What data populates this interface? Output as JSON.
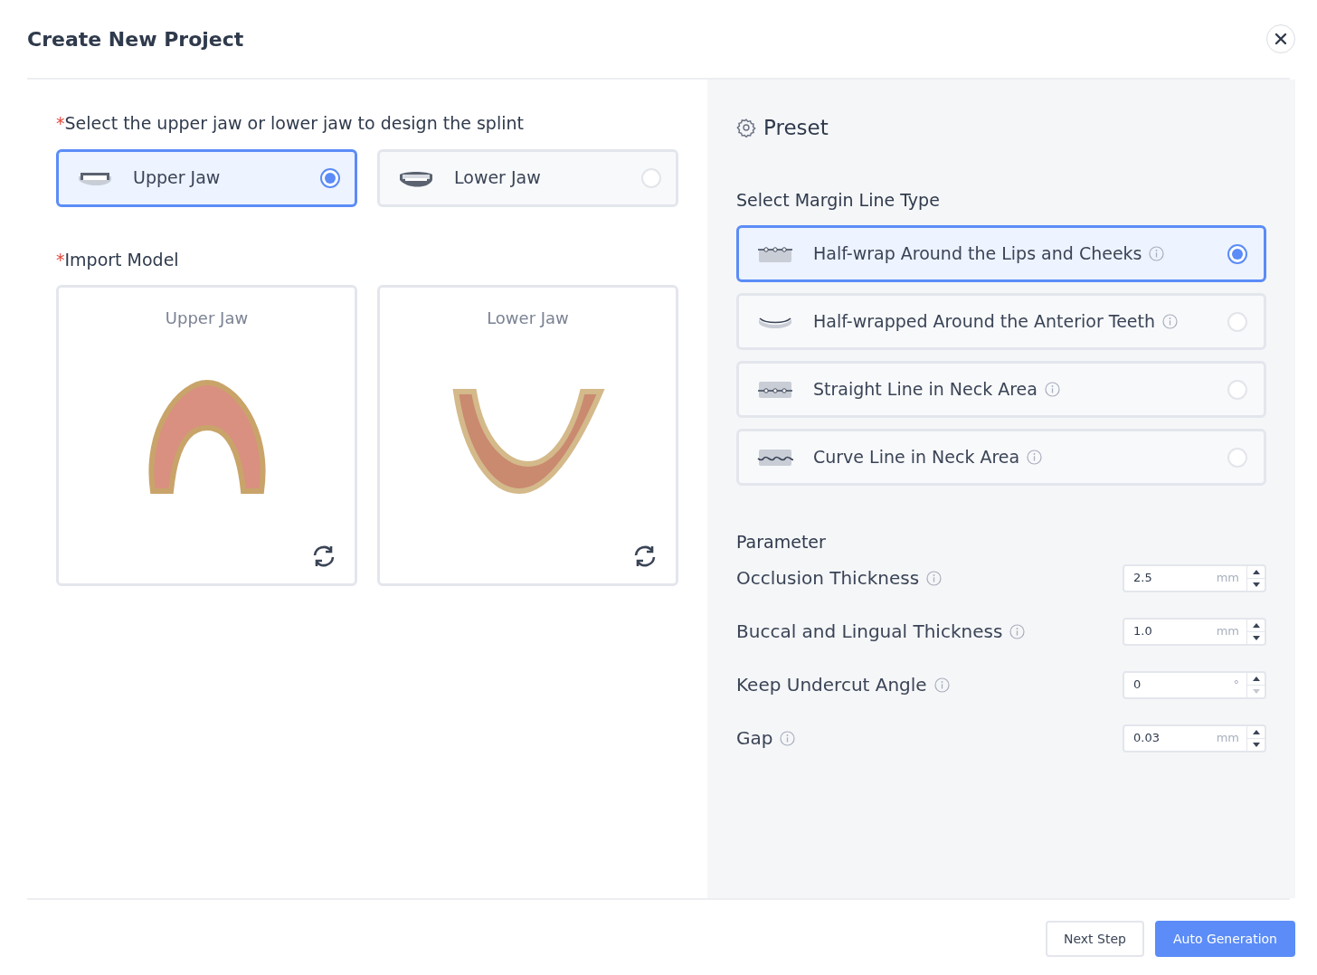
{
  "dialog": {
    "title": "Create New Project"
  },
  "jaw_section": {
    "required_mark": "*",
    "label": "Select the upper jaw or lower jaw to design the splint",
    "options": [
      {
        "label": "Upper Jaw",
        "selected": true,
        "kind": "upper"
      },
      {
        "label": "Lower Jaw",
        "selected": false,
        "kind": "lower"
      }
    ]
  },
  "import_section": {
    "required_mark": "*",
    "label": "Import Model",
    "models": [
      {
        "label": "Upper Jaw",
        "kind": "upper"
      },
      {
        "label": "Lower Jaw",
        "kind": "lower"
      }
    ]
  },
  "preset": {
    "title": "Preset",
    "margin_label": "Select Margin Line Type",
    "margin_types": [
      {
        "label": "Half-wrap Around the Lips and Cheeks",
        "selected": true,
        "kind": "lips"
      },
      {
        "label": "Half-wrapped Around the Anterior Teeth",
        "selected": false,
        "kind": "anterior"
      },
      {
        "label": "Straight Line in Neck Area",
        "selected": false,
        "kind": "straight"
      },
      {
        "label": "Curve Line in Neck Area",
        "selected": false,
        "kind": "curve"
      }
    ],
    "parameter_label": "Parameter",
    "parameters": [
      {
        "label": "Occlusion Thickness",
        "value": "2.5",
        "unit": "mm",
        "down_disabled": false
      },
      {
        "label": "Buccal and Lingual Thickness",
        "value": "1.0",
        "unit": "mm",
        "down_disabled": false
      },
      {
        "label": "Keep Undercut Angle",
        "value": "0",
        "unit": "°",
        "down_disabled": true
      },
      {
        "label": "Gap",
        "value": "0.03",
        "unit": "mm",
        "down_disabled": false
      }
    ]
  },
  "footer": {
    "buttons": [
      {
        "label": "Next Step",
        "kind": "secondary"
      },
      {
        "label": "Auto Generation",
        "kind": "primary"
      }
    ]
  }
}
